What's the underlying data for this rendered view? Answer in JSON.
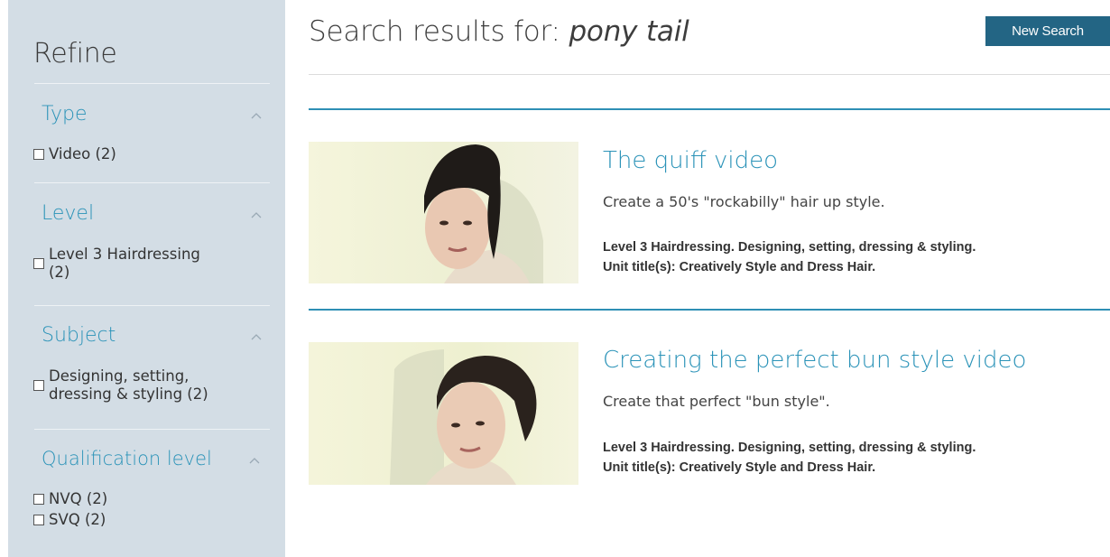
{
  "sidebar": {
    "title": "Refine",
    "groups": [
      {
        "heading": "Type",
        "options": [
          {
            "label": "Video (2)"
          }
        ]
      },
      {
        "heading": "Level",
        "options": [
          {
            "label_line1": "Level 3 Hairdressing",
            "label_line2": "(2)"
          }
        ]
      },
      {
        "heading": "Subject",
        "options": [
          {
            "label_line1": "Designing, setting,",
            "label_line2": "dressing & styling (2)"
          }
        ]
      },
      {
        "heading": "Qualification level",
        "options": [
          {
            "label": "NVQ (2)"
          },
          {
            "label": "SVQ (2)"
          }
        ]
      }
    ]
  },
  "header": {
    "prefix": "Search results for:",
    "query": "pony tail",
    "new_search_label": "New Search"
  },
  "results": [
    {
      "title": "The quiff video",
      "description": "Create a 50's \"rockabilly\" hair up style.",
      "meta_line1": "Level 3 Hairdressing. Designing, setting, dressing & styling.",
      "meta_line2": "Unit title(s): Creatively Style and Dress Hair."
    },
    {
      "title": "Creating the perfect bun style video",
      "description": "Create that perfect \"bun style\".",
      "meta_line1": "Level 3 Hairdressing. Designing, setting, dressing & styling.",
      "meta_line2": "Unit title(s): Creatively Style and Dress Hair."
    }
  ],
  "colors": {
    "accent": "#2b93b8",
    "sidebar_bg": "#d3dde5",
    "button_bg": "#236584"
  },
  "icons": {
    "group_toggle": "chevron-up-icon",
    "option": "checkbox-icon"
  }
}
